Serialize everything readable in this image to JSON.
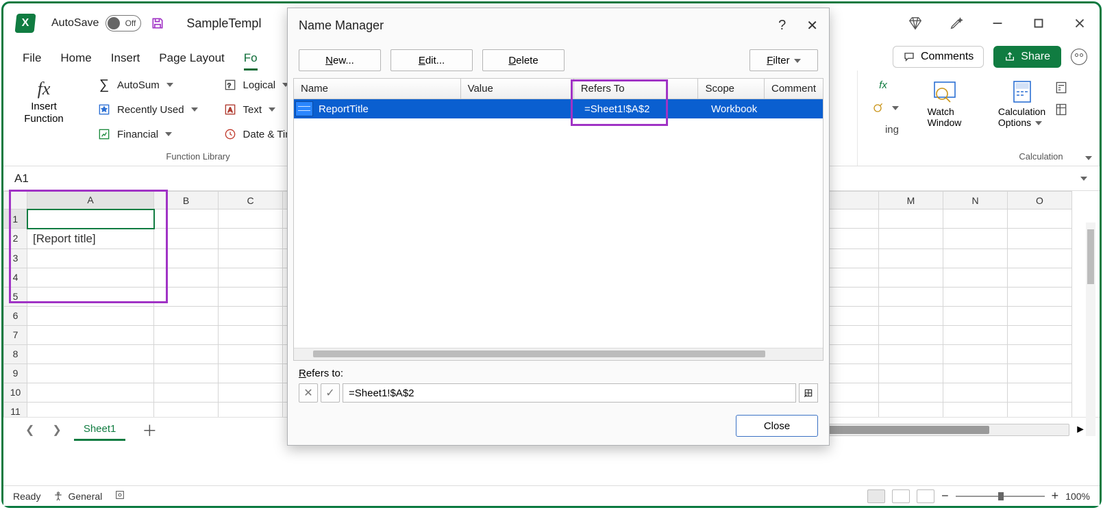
{
  "titlebar": {
    "autosave_label": "AutoSave",
    "autosave_state": "Off",
    "document_title": "SampleTempl"
  },
  "tabs": {
    "file": "File",
    "home": "Home",
    "insert": "Insert",
    "page_layout": "Page Layout",
    "formulas": "Fo"
  },
  "ribbon": {
    "insert_function": "Insert\nFunction",
    "autosum": "AutoSum",
    "recently_used": "Recently Used",
    "financial": "Financial",
    "logical": "Logical",
    "text": "Text",
    "date_time": "Date & Time",
    "group_function_library": "Function Library",
    "watch_window": "Watch\nWindow",
    "calc_options": "Calculation\nOptions",
    "group_calculation": "Calculation",
    "comments": "Comments",
    "share": "Share"
  },
  "formula_bar": {
    "name_box": "A1"
  },
  "grid": {
    "columns": [
      "A",
      "B",
      "C",
      "M",
      "N",
      "O"
    ],
    "rows": [
      "1",
      "2",
      "3",
      "4",
      "5",
      "6",
      "7",
      "8",
      "9",
      "10",
      "11"
    ],
    "a2_value": "[Report title]"
  },
  "sheet_tabs": {
    "active": "Sheet1"
  },
  "status": {
    "ready": "Ready",
    "general": "General",
    "zoom": "100%"
  },
  "dialog": {
    "title": "Name Manager",
    "new_btn": "New...",
    "edit_btn": "Edit...",
    "delete_btn": "Delete",
    "filter_btn": "Filter",
    "col_name": "Name",
    "col_value": "Value",
    "col_refers": "Refers To",
    "col_scope": "Scope",
    "col_comment": "Comment",
    "row_name": "ReportTitle",
    "row_refers": "=Sheet1!$A$2",
    "row_scope": "Workbook",
    "refers_label": "Refers to:",
    "refers_value": "=Sheet1!$A$2",
    "close": "Close"
  }
}
